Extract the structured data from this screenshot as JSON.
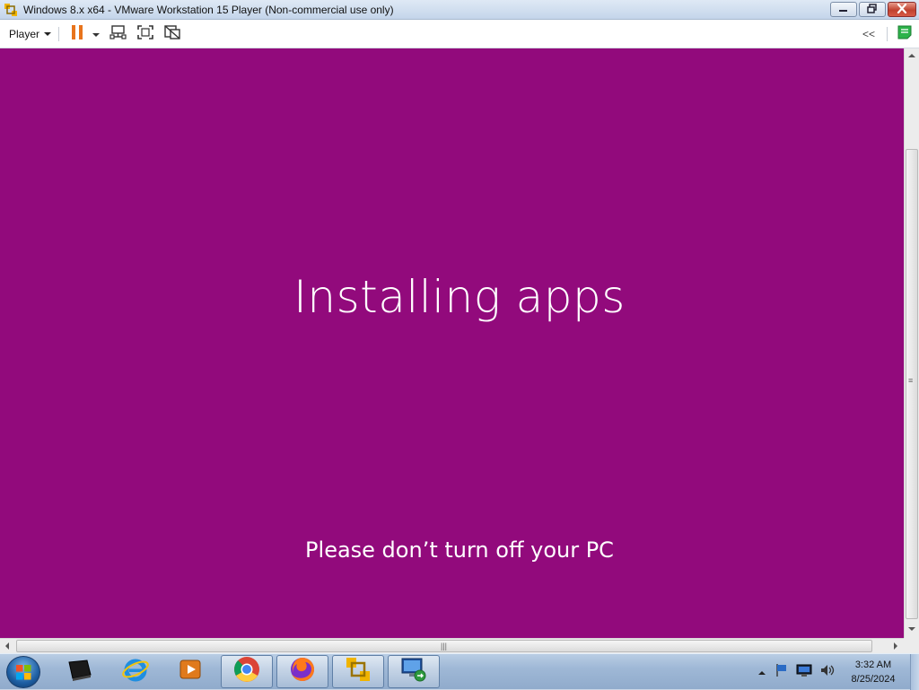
{
  "window": {
    "title": "Windows 8.x x64 - VMware Workstation 15 Player (Non-commercial use only)"
  },
  "toolbar": {
    "player_label": "Player",
    "collapse_label": "<<"
  },
  "vm": {
    "background_color": "#920a7c",
    "heading": "Installing apps",
    "subtext": "Please don’t turn off your PC"
  },
  "taskbar": {
    "apps": [
      "start-orb",
      "media-device-icon",
      "internet-explorer-icon",
      "media-player-icon",
      "chrome-icon",
      "firefox-icon",
      "vmware-icon",
      "remote-desktop-icon"
    ],
    "clock_time": "3:32 AM",
    "clock_date": "8/25/2024"
  },
  "colors": {
    "close_button": "#c0422f",
    "pause_accent": "#e8741c",
    "taskbar": "#9fb8d6"
  }
}
